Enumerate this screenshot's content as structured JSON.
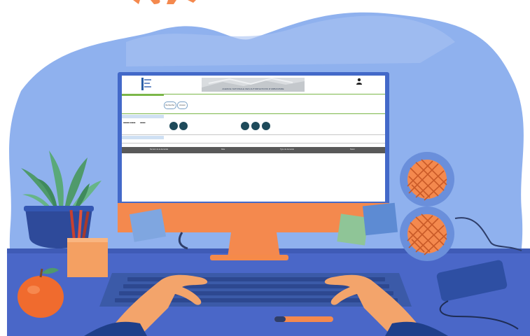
{
  "colors": {
    "blob": "#8fb1ee",
    "desk": "#4a67c8",
    "monitor_frame": "#4369c9",
    "monitor_stand": "#f4894e",
    "keyboard": "#3b5aa8",
    "skin": "#f3a46b",
    "table_header": "#595959",
    "accent_green": "#7bb749"
  },
  "screen": {
    "banner_text": "AGENCE NATIONALE DES AUTORISATIONS D'URBANISME",
    "btn1": "Rechercher",
    "btn2": "Annuler",
    "table_headers": [
      "Numéro de la demande",
      "Date",
      "Type de demande",
      "Statut"
    ]
  },
  "icons": {
    "user": "user-icon",
    "logo": "agency-logo-icon"
  }
}
